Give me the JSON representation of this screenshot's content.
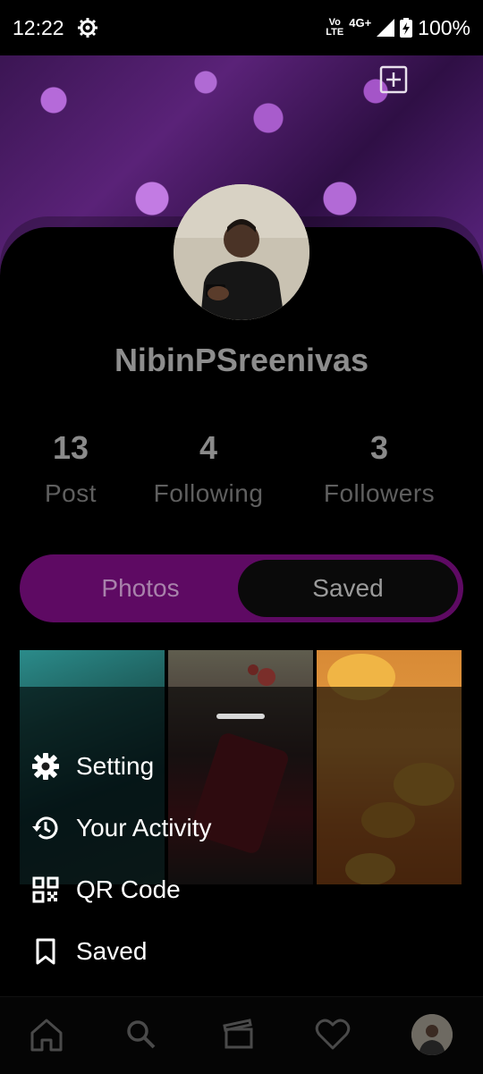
{
  "status_bar": {
    "time": "12:22",
    "net_top": "Vo",
    "net_bottom": "LTE",
    "network": "4G+",
    "battery": "100%"
  },
  "cover": {
    "add_icon": "add-box-icon",
    "grid_icon": "grid-add-icon"
  },
  "profile": {
    "username": "NibinPSreenivas",
    "stats": [
      {
        "value": "13",
        "label": "Post"
      },
      {
        "value": "4",
        "label": "Following"
      },
      {
        "value": "3",
        "label": "Followers"
      }
    ]
  },
  "tabs": {
    "photos": "Photos",
    "saved": "Saved",
    "active": "saved",
    "accent": "#5e0a63"
  },
  "menu": {
    "items": [
      {
        "label": "Setting",
        "icon": "gear-icon"
      },
      {
        "label": "Your Activity",
        "icon": "history-icon"
      },
      {
        "label": "QR Code",
        "icon": "qr-code-icon"
      },
      {
        "label": "Saved",
        "icon": "bookmark-icon"
      }
    ]
  },
  "bottom_nav": {
    "items": [
      "home-icon",
      "search-icon",
      "reels-icon",
      "heart-icon",
      "avatar"
    ]
  }
}
